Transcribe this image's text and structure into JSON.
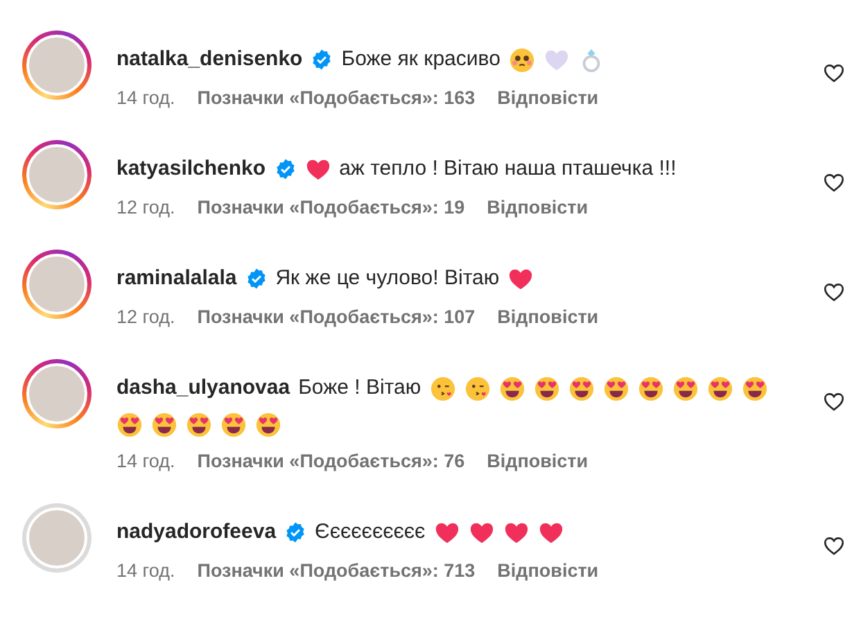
{
  "comments": [
    {
      "username": "natalka_denisenko",
      "verified": true,
      "story_ring": true,
      "parts": [
        {
          "kind": "text",
          "text": "Боже як красиво"
        },
        {
          "kind": "smiling-face"
        },
        {
          "kind": "white-heart"
        },
        {
          "kind": "ring"
        }
      ],
      "time": "14 год.",
      "likes": "Позначки «Подобається»: 163",
      "reply": "Відповісти"
    },
    {
      "username": "katyasilchenko",
      "verified": true,
      "story_ring": true,
      "parts": [
        {
          "kind": "red-heart"
        },
        {
          "kind": "text",
          "text": "аж тепло ! Вітаю наша пташечка !!!"
        }
      ],
      "time": "12 год.",
      "likes": "Позначки «Подобається»: 19",
      "reply": "Відповісти"
    },
    {
      "username": "raminalalala",
      "verified": true,
      "story_ring": true,
      "parts": [
        {
          "kind": "text",
          "text": "Як же це чулово! Вітаю"
        },
        {
          "kind": "red-heart"
        }
      ],
      "time": "12 год.",
      "likes": "Позначки «Подобається»: 107",
      "reply": "Відповісти"
    },
    {
      "username": "dasha_ulyanovaa",
      "verified": false,
      "story_ring": true,
      "parts": [
        {
          "kind": "text",
          "text": "Боже ! Вітаю"
        },
        {
          "kind": "kissing-face"
        },
        {
          "kind": "kissing-face"
        },
        {
          "kind": "heart-eyes"
        },
        {
          "kind": "heart-eyes"
        },
        {
          "kind": "heart-eyes"
        },
        {
          "kind": "heart-eyes"
        },
        {
          "kind": "heart-eyes"
        },
        {
          "kind": "heart-eyes"
        },
        {
          "kind": "heart-eyes"
        },
        {
          "kind": "heart-eyes"
        },
        {
          "kind": "heart-eyes"
        },
        {
          "kind": "heart-eyes"
        },
        {
          "kind": "heart-eyes"
        },
        {
          "kind": "heart-eyes"
        },
        {
          "kind": "heart-eyes"
        }
      ],
      "time": "14 год.",
      "likes": "Позначки «Подобається»: 76",
      "reply": "Відповісти"
    },
    {
      "username": "nadyadorofeeva",
      "verified": true,
      "story_ring": false,
      "parts": [
        {
          "kind": "text",
          "text": "Єєєєєєєєєє"
        },
        {
          "kind": "red-heart"
        },
        {
          "kind": "red-heart"
        },
        {
          "kind": "red-heart"
        },
        {
          "kind": "red-heart"
        }
      ],
      "time": "14 год.",
      "likes": "Позначки «Подобається»: 713",
      "reply": "Відповісти"
    }
  ]
}
